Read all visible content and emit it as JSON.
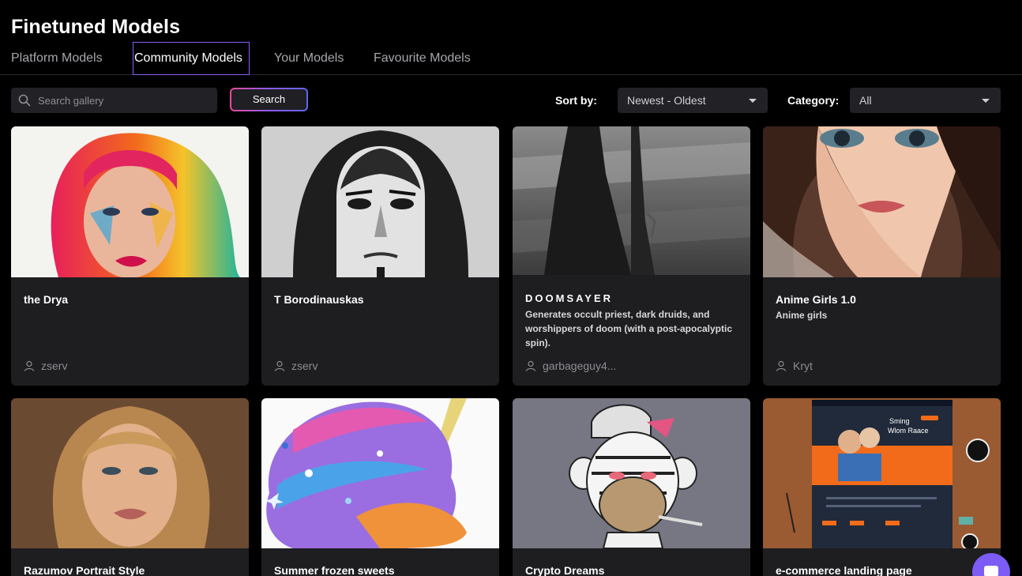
{
  "header": {
    "title": "Finetuned Models"
  },
  "tabs": [
    {
      "label": "Platform Models",
      "active": false
    },
    {
      "label": "Community Models",
      "active": true
    },
    {
      "label": "Your Models",
      "active": false
    },
    {
      "label": "Favourite Models",
      "active": false
    }
  ],
  "search": {
    "placeholder": "Search gallery",
    "value": "",
    "button_label": "Search"
  },
  "sort": {
    "label": "Sort by:",
    "selected": "Newest - Oldest"
  },
  "category": {
    "label": "Category:",
    "selected": "All"
  },
  "colors": {
    "accent": "#8b5cf6",
    "background": "#000000",
    "card": "#1e1e21",
    "muted_text": "#8c8c93"
  },
  "cards": [
    {
      "name": "the Drya",
      "description": "",
      "author": "zserv",
      "thumb": "colorful-portrait"
    },
    {
      "name": "T Borodinauskas",
      "description": "",
      "author": "zserv",
      "thumb": "monochrome-portrait"
    },
    {
      "name": "DOOMSAYER",
      "description": "Generates occult priest, dark druids, and worshippers of doom (with a post-apocalyptic spin).",
      "author": "garbageguy4...",
      "thumb": "dark-robed-figure"
    },
    {
      "name": "Anime Girls 1.0",
      "description": "Anime girls",
      "author": "Kryt",
      "thumb": "anime-girl"
    },
    {
      "name": "Razumov Portrait Style",
      "description": "",
      "author": "",
      "thumb": "blonde-portrait"
    },
    {
      "name": "Summer frozen sweets",
      "description": "",
      "author": "",
      "thumb": "watercolor-icecream"
    },
    {
      "name": "Crypto Dreams",
      "description": "",
      "author": "",
      "thumb": "ape-cartoon"
    },
    {
      "name": "e-commerce landing page",
      "description": "",
      "author": "",
      "thumb": "landing-page-mockup",
      "mockup_text": "Sming Wlom Raace"
    }
  ]
}
